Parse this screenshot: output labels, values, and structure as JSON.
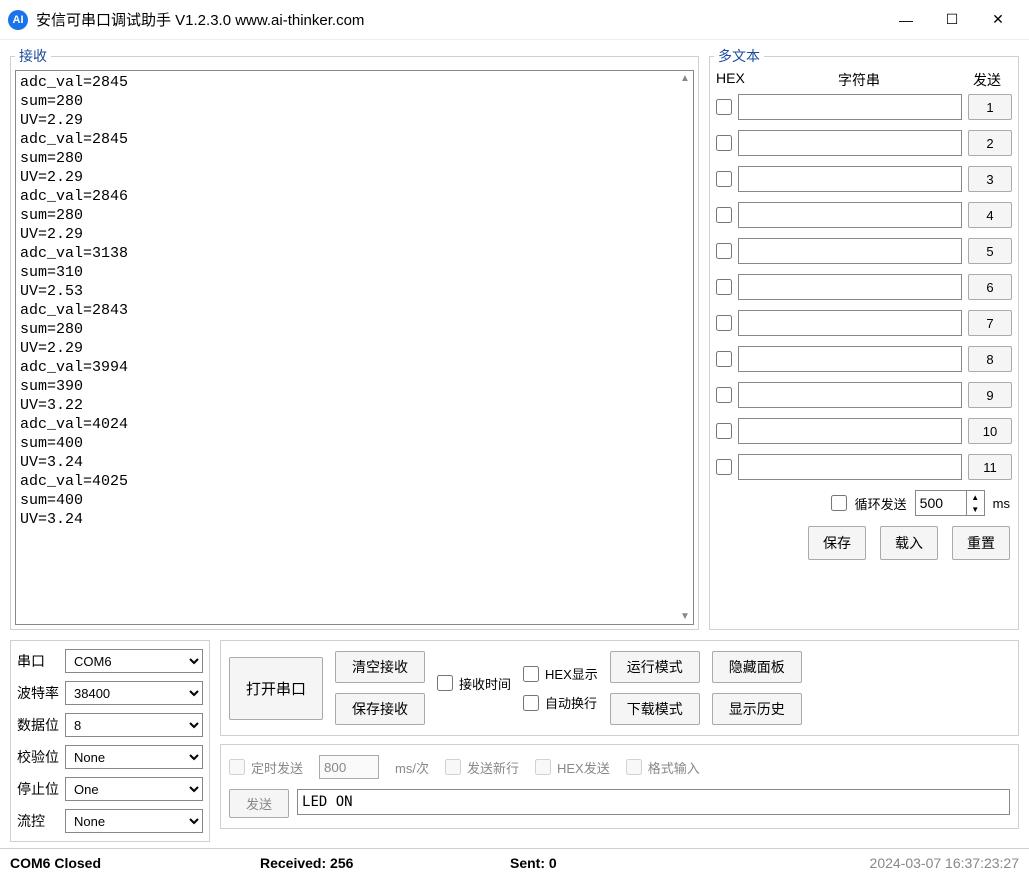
{
  "titlebar": {
    "logo": "AI",
    "title": "安信可串口调试助手 V1.2.3.0    www.ai-thinker.com"
  },
  "receive": {
    "legend": "接收",
    "text": "adc_val=2845\nsum=280\nUV=2.29\nadc_val=2845\nsum=280\nUV=2.29\nadc_val=2846\nsum=280\nUV=2.29\nadc_val=3138\nsum=310\nUV=2.53\nadc_val=2843\nsum=280\nUV=2.29\nadc_val=3994\nsum=390\nUV=3.22\nadc_val=4024\nsum=400\nUV=3.24\nadc_val=4025\nsum=400\nUV=3.24"
  },
  "multi": {
    "legend": "多文本",
    "hex": "HEX",
    "str": "字符串",
    "send": "发送",
    "rows": [
      {
        "n": "1",
        "v": ""
      },
      {
        "n": "2",
        "v": ""
      },
      {
        "n": "3",
        "v": ""
      },
      {
        "n": "4",
        "v": ""
      },
      {
        "n": "5",
        "v": ""
      },
      {
        "n": "6",
        "v": ""
      },
      {
        "n": "7",
        "v": ""
      },
      {
        "n": "8",
        "v": ""
      },
      {
        "n": "9",
        "v": ""
      },
      {
        "n": "10",
        "v": ""
      },
      {
        "n": "11",
        "v": ""
      }
    ],
    "loop_label": "循环发送",
    "loop_value": "500",
    "ms": "ms",
    "save": "保存",
    "load": "载入",
    "reset": "重置"
  },
  "serial": {
    "port_label": "串口",
    "port": "COM6",
    "baud_label": "波特率",
    "baud": "38400",
    "databits_label": "数据位",
    "databits": "8",
    "parity_label": "校验位",
    "parity": "None",
    "stopbits_label": "停止位",
    "stopbits": "One",
    "flow_label": "流控",
    "flow": "None"
  },
  "mid": {
    "open": "打开串口",
    "clear_recv": "清空接收",
    "save_recv": "保存接收",
    "recv_time": "接收时间",
    "hex_disp": "HEX显示",
    "auto_wrap": "自动换行",
    "run_mode": "运行模式",
    "download_mode": "下载模式",
    "hide_panel": "隐藏面板",
    "show_history": "显示历史"
  },
  "send": {
    "timer_send": "定时发送",
    "interval": "800",
    "unit": "ms/次",
    "send_newline": "发送新行",
    "hex_send": "HEX发送",
    "format_input": "格式输入",
    "send_btn": "发送",
    "value": "LED ON"
  },
  "status": {
    "port": "COM6 Closed",
    "received": "Received: 256",
    "sent": "Sent: 0",
    "time": "2024-03-07 16:37:23:27"
  }
}
